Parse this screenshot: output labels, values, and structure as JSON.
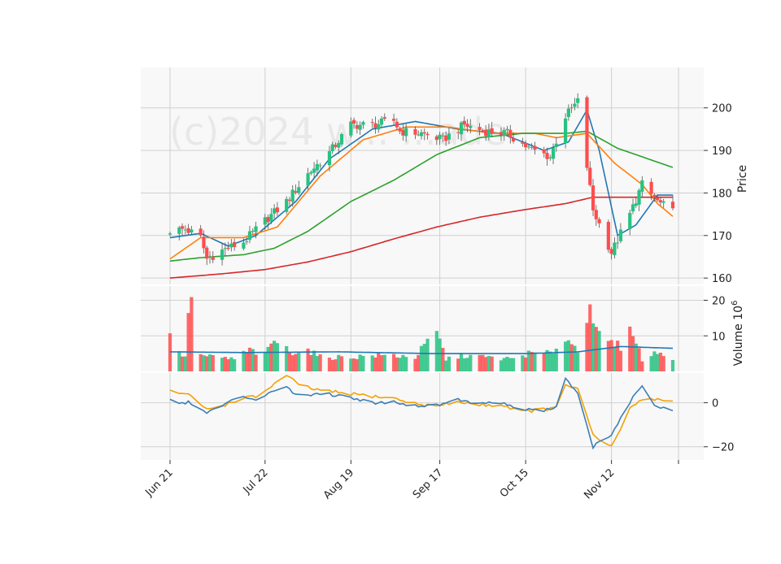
{
  "chart_data": {
    "type": "candlestick",
    "watermark": "(c)2024 w... ...ade",
    "colors": {
      "up": "#27c281",
      "down": "#ff4d4d",
      "ma_short": "#1f77b4",
      "ma_mid": "#ff7f0e",
      "ma_long": "#2ca02c",
      "ma_longest": "#d62728",
      "volume_avg": "#1f77b4",
      "osc_line": "#3b7fb8",
      "osc_signal": "#f5a000",
      "grid": "#d0d0d0",
      "panel_bg": "#f8f8f8"
    },
    "x_labels": [
      {
        "label": "Jun 21",
        "date": "2024-06-21"
      },
      {
        "label": "Jul 22",
        "date": "2024-07-22"
      },
      {
        "label": "Aug 19",
        "date": "2024-08-19"
      },
      {
        "label": "Sep 17",
        "date": "2024-09-17"
      },
      {
        "label": "Oct 15",
        "date": "2024-10-15"
      },
      {
        "label": "Nov 12",
        "date": "2024-11-12"
      }
    ],
    "price_panel": {
      "ylabel": "Price",
      "yticks": [
        "160",
        "170",
        "180",
        "190",
        "200"
      ],
      "ylim": [
        158.5,
        209.5
      ],
      "close_anchors": [
        [
          "2024-06-21",
          171.2
        ],
        [
          "2024-06-26",
          171.5
        ],
        [
          "2024-07-01",
          169.5
        ],
        [
          "2024-07-03",
          164.5
        ],
        [
          "2024-07-08",
          166.5
        ],
        [
          "2024-07-15",
          168.5
        ],
        [
          "2024-07-22",
          173.5
        ],
        [
          "2024-07-29",
          178.0
        ],
        [
          "2024-08-05",
          184.5
        ],
        [
          "2024-08-12",
          189.5
        ],
        [
          "2024-08-19",
          196.0
        ],
        [
          "2024-08-26",
          196.0
        ],
        [
          "2024-09-02",
          197.0
        ],
        [
          "2024-09-04",
          194.5
        ],
        [
          "2024-09-11",
          194.0
        ],
        [
          "2024-09-18",
          192.5
        ],
        [
          "2024-09-25",
          196.0
        ],
        [
          "2024-10-02",
          194.5
        ],
        [
          "2024-10-09",
          194.0
        ],
        [
          "2024-10-16",
          190.5
        ],
        [
          "2024-10-23",
          188.5
        ],
        [
          "2024-10-28",
          198.0
        ],
        [
          "2024-11-01",
          201.5
        ],
        [
          "2024-11-06",
          176.0
        ],
        [
          "2024-11-12",
          166.0
        ],
        [
          "2024-11-18",
          175.0
        ],
        [
          "2024-11-22",
          182.0
        ],
        [
          "2024-11-27",
          178.0
        ],
        [
          "2024-12-02",
          175.5
        ]
      ],
      "moving_averages": [
        {
          "key": "ma_short",
          "points": [
            [
              "2024-06-21",
              169.5
            ],
            [
              "2024-07-01",
              170.5
            ],
            [
              "2024-07-10",
              167.5
            ],
            [
              "2024-07-19",
              170.0
            ],
            [
              "2024-08-01",
              178.0
            ],
            [
              "2024-08-12",
              188.0
            ],
            [
              "2024-08-26",
              195.0
            ],
            [
              "2024-09-09",
              196.8
            ],
            [
              "2024-09-23",
              195.0
            ],
            [
              "2024-10-07",
              194.0
            ],
            [
              "2024-10-21",
              190.0
            ],
            [
              "2024-10-29",
              192.0
            ],
            [
              "2024-11-04",
              199.5
            ],
            [
              "2024-11-08",
              190.0
            ],
            [
              "2024-11-14",
              170.0
            ],
            [
              "2024-11-20",
              172.5
            ],
            [
              "2024-11-27",
              179.5
            ],
            [
              "2024-12-02",
              179.5
            ]
          ]
        },
        {
          "key": "ma_mid",
          "points": [
            [
              "2024-06-21",
              164.5
            ],
            [
              "2024-07-01",
              169.5
            ],
            [
              "2024-07-15",
              169.5
            ],
            [
              "2024-07-26",
              172.0
            ],
            [
              "2024-08-09",
              184.0
            ],
            [
              "2024-08-23",
              192.5
            ],
            [
              "2024-09-06",
              195.5
            ],
            [
              "2024-09-20",
              195.5
            ],
            [
              "2024-10-04",
              194.0
            ],
            [
              "2024-10-18",
              194.0
            ],
            [
              "2024-10-25",
              193.0
            ],
            [
              "2024-11-04",
              194.0
            ],
            [
              "2024-11-13",
              187.0
            ],
            [
              "2024-11-22",
              182.0
            ],
            [
              "2024-11-27",
              177.5
            ],
            [
              "2024-12-02",
              174.5
            ]
          ]
        },
        {
          "key": "ma_long",
          "points": [
            [
              "2024-06-21",
              164.0
            ],
            [
              "2024-07-01",
              164.8
            ],
            [
              "2024-07-15",
              165.5
            ],
            [
              "2024-07-25",
              167.0
            ],
            [
              "2024-08-05",
              171.0
            ],
            [
              "2024-08-19",
              178.0
            ],
            [
              "2024-09-02",
              183.0
            ],
            [
              "2024-09-16",
              189.0
            ],
            [
              "2024-09-30",
              193.0
            ],
            [
              "2024-10-14",
              194.0
            ],
            [
              "2024-10-28",
              194.0
            ],
            [
              "2024-11-04",
              194.5
            ],
            [
              "2024-11-14",
              190.5
            ],
            [
              "2024-11-22",
              188.5
            ],
            [
              "2024-12-02",
              186.0
            ]
          ]
        },
        {
          "key": "ma_longest",
          "points": [
            [
              "2024-06-21",
              160.0
            ],
            [
              "2024-07-08",
              161.0
            ],
            [
              "2024-07-22",
              162.0
            ],
            [
              "2024-08-05",
              163.8
            ],
            [
              "2024-08-19",
              166.2
            ],
            [
              "2024-09-02",
              169.2
            ],
            [
              "2024-09-16",
              172.0
            ],
            [
              "2024-09-30",
              174.3
            ],
            [
              "2024-10-14",
              176.0
            ],
            [
              "2024-10-28",
              177.5
            ],
            [
              "2024-11-06",
              179.0
            ],
            [
              "2024-11-20",
              179.0
            ],
            [
              "2024-12-02",
              179.0
            ]
          ]
        }
      ]
    },
    "volume_panel": {
      "ylabel": "Volume  10",
      "ylabel_exponent": "6",
      "yticks": [
        "10",
        "20"
      ],
      "ylim": [
        0,
        24
      ],
      "anchors": [
        [
          "2024-06-21",
          11.5
        ],
        [
          "2024-06-24",
          5.0
        ],
        [
          "2024-06-26",
          4.5
        ],
        [
          "2024-06-28",
          23.5
        ],
        [
          "2024-07-01",
          4.5
        ],
        [
          "2024-07-05",
          4.0
        ],
        [
          "2024-07-12",
          3.5
        ],
        [
          "2024-07-17",
          6.0
        ],
        [
          "2024-07-22",
          4.5
        ],
        [
          "2024-07-25",
          9.0
        ],
        [
          "2024-07-30",
          5.5
        ],
        [
          "2024-08-05",
          6.0
        ],
        [
          "2024-08-09",
          4.0
        ],
        [
          "2024-08-19",
          4.0
        ],
        [
          "2024-08-26",
          4.5
        ],
        [
          "2024-09-02",
          4.5
        ],
        [
          "2024-09-09",
          4.0
        ],
        [
          "2024-09-16",
          11.0
        ],
        [
          "2024-09-19",
          3.5
        ],
        [
          "2024-09-25",
          4.5
        ],
        [
          "2024-10-02",
          4.0
        ],
        [
          "2024-10-10",
          3.5
        ],
        [
          "2024-10-16",
          5.0
        ],
        [
          "2024-10-23",
          5.0
        ],
        [
          "2024-10-28",
          9.5
        ],
        [
          "2024-11-01",
          6.0
        ],
        [
          "2024-11-05",
          20.5
        ],
        [
          "2024-11-07",
          10.5
        ],
        [
          "2024-11-11",
          8.0
        ],
        [
          "2024-11-15",
          7.0
        ],
        [
          "2024-11-19",
          12.0
        ],
        [
          "2024-11-22",
          3.0
        ],
        [
          "2024-11-27",
          5.5
        ],
        [
          "2024-12-02",
          4.0
        ]
      ],
      "average": [
        [
          "2024-06-21",
          5.5
        ],
        [
          "2024-07-15",
          5.3
        ],
        [
          "2024-08-15",
          5.5
        ],
        [
          "2024-09-15",
          5.0
        ],
        [
          "2024-10-15",
          5.0
        ],
        [
          "2024-11-01",
          5.5
        ],
        [
          "2024-11-15",
          7.0
        ],
        [
          "2024-12-02",
          6.5
        ]
      ]
    },
    "oscillator_panel": {
      "yticks": [
        "0",
        "−20"
      ],
      "ylim": [
        -26,
        13.5
      ],
      "line": [
        [
          "2024-06-21",
          1.0
        ],
        [
          "2024-06-27",
          0.0
        ],
        [
          "2024-07-03",
          -4.5
        ],
        [
          "2024-07-10",
          0.0
        ],
        [
          "2024-07-15",
          3.0
        ],
        [
          "2024-07-19",
          1.5
        ],
        [
          "2024-07-25",
          6.0
        ],
        [
          "2024-07-29",
          7.0
        ],
        [
          "2024-08-02",
          3.0
        ],
        [
          "2024-08-09",
          4.5
        ],
        [
          "2024-08-19",
          2.5
        ],
        [
          "2024-08-26",
          0.0
        ],
        [
          "2024-09-02",
          0.5
        ],
        [
          "2024-09-09",
          -1.5
        ],
        [
          "2024-09-16",
          -1.0
        ],
        [
          "2024-09-23",
          1.5
        ],
        [
          "2024-09-30",
          -0.5
        ],
        [
          "2024-10-07",
          0.0
        ],
        [
          "2024-10-14",
          -3.0
        ],
        [
          "2024-10-21",
          -3.5
        ],
        [
          "2024-10-25",
          -2.0
        ],
        [
          "2024-10-28",
          10.5
        ],
        [
          "2024-11-01",
          4.5
        ],
        [
          "2024-11-06",
          -20.0
        ],
        [
          "2024-11-12",
          -15.0
        ],
        [
          "2024-11-18",
          0.5
        ],
        [
          "2024-11-22",
          7.0
        ],
        [
          "2024-11-27",
          -2.5
        ],
        [
          "2024-12-02",
          -3.0
        ]
      ],
      "signal": [
        [
          "2024-06-21",
          5.5
        ],
        [
          "2024-06-27",
          3.5
        ],
        [
          "2024-07-03",
          -3.0
        ],
        [
          "2024-07-10",
          -0.5
        ],
        [
          "2024-07-15",
          2.5
        ],
        [
          "2024-07-19",
          2.5
        ],
        [
          "2024-07-25",
          8.5
        ],
        [
          "2024-07-29",
          12.5
        ],
        [
          "2024-08-02",
          8.0
        ],
        [
          "2024-08-09",
          5.5
        ],
        [
          "2024-08-19",
          4.0
        ],
        [
          "2024-08-26",
          3.0
        ],
        [
          "2024-09-02",
          2.0
        ],
        [
          "2024-09-09",
          -0.5
        ],
        [
          "2024-09-16",
          -1.5
        ],
        [
          "2024-09-23",
          0.5
        ],
        [
          "2024-09-30",
          -1.0
        ],
        [
          "2024-10-07",
          -1.0
        ],
        [
          "2024-10-14",
          -4.0
        ],
        [
          "2024-10-21",
          -3.0
        ],
        [
          "2024-10-25",
          -2.5
        ],
        [
          "2024-10-28",
          8.5
        ],
        [
          "2024-11-01",
          6.0
        ],
        [
          "2024-11-06",
          -15.0
        ],
        [
          "2024-11-12",
          -20.0
        ],
        [
          "2024-11-18",
          -3.0
        ],
        [
          "2024-11-22",
          2.0
        ],
        [
          "2024-11-27",
          1.5
        ],
        [
          "2024-12-02",
          1.0
        ]
      ]
    }
  }
}
